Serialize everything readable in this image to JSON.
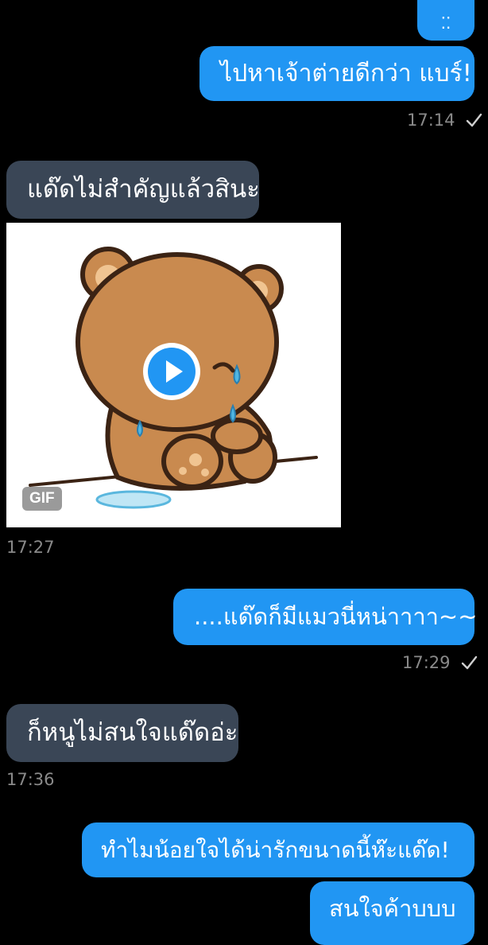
{
  "messages": {
    "m0": {
      "text": "⁚⁚"
    },
    "m1": {
      "text": "ไปหาเจ้าต่ายดีกว่า แบร์!"
    },
    "t1": {
      "time": "17:14"
    },
    "m2": {
      "text": "แด๊ดไม่สำคัญแล้วสินะ"
    },
    "gif": {
      "badge": "GIF",
      "play_icon": "play-icon"
    },
    "t2": {
      "time": "17:27"
    },
    "m3": {
      "text": "....แด๊ดก็มีแมวนี่หน่าาาา~~"
    },
    "t3": {
      "time": "17:29"
    },
    "m4": {
      "text": "ก็หนูไม่สนใจแด๊ดอ่ะ"
    },
    "t4": {
      "time": "17:36"
    },
    "m5": {
      "text": "ทำไมน้อยใจได้น่ารักขนาดนี้ห๊ะแด๊ด!"
    },
    "m6": {
      "text": "สนใจค้าบบบ"
    }
  },
  "colors": {
    "background": "#000000",
    "outgoing_bubble": "#2196f3",
    "incoming_bubble": "#3a4656",
    "timestamp": "#8a8a8a"
  }
}
